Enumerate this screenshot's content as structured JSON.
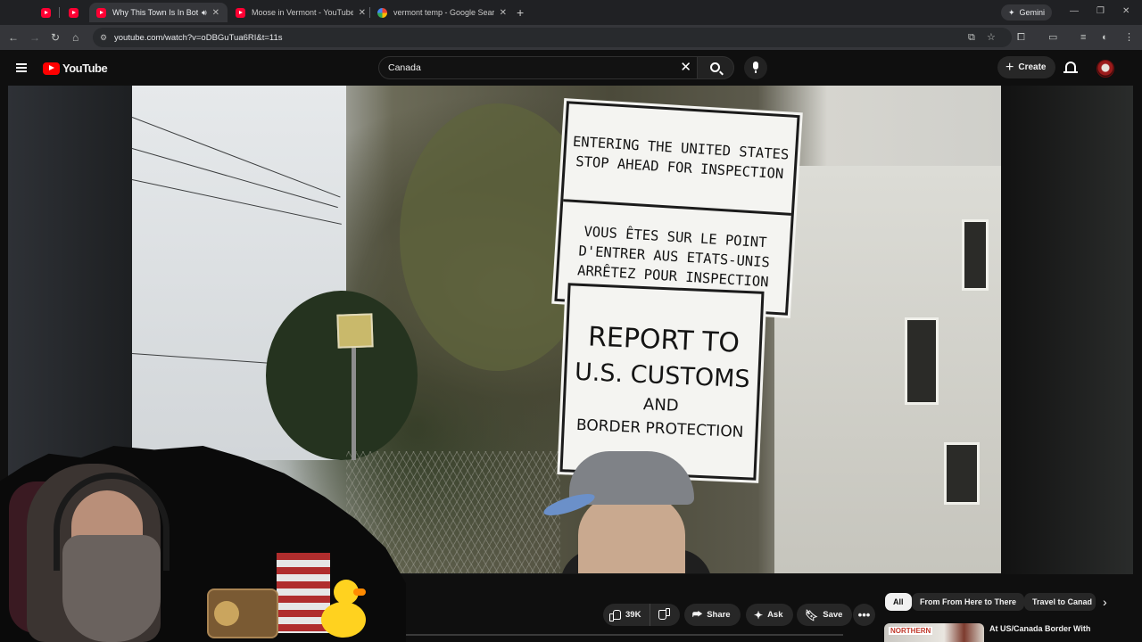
{
  "browser": {
    "tabs": [
      {
        "title": "",
        "favicon": "youtube-icon"
      },
      {
        "title": "",
        "favicon": "youtube-icon"
      },
      {
        "title": "Why This Town Is In Both Th",
        "favicon": "youtube-icon",
        "active": true,
        "audio": true
      },
      {
        "title": "Moose in Vermont - YouTube",
        "favicon": "youtube-icon"
      },
      {
        "title": "vermont temp - Google Search",
        "favicon": "google-icon"
      }
    ],
    "new_tab": "+",
    "gemini_label": "Gemini",
    "url": "youtube.com/watch?v=oDBGuTua6RI&t=11s"
  },
  "youtube": {
    "logo_text": "YouTube",
    "search_value": "Canada",
    "create_label": "Create",
    "actions": {
      "likes": "39K",
      "share": "Share",
      "ask": "Ask",
      "save": "Save"
    },
    "chips": [
      "All",
      "From From Here to There",
      "Travel to Canad"
    ],
    "recommendation": {
      "thumb_label": "NORTHERN",
      "title": "At US/Canada Border With"
    }
  },
  "video": {
    "sign_top_en": [
      "ENTERING THE UNITED STATES",
      "STOP AHEAD FOR INSPECTION"
    ],
    "sign_top_fr": [
      "VOUS ÊTES SUR LE POINT",
      "D'ENTRER AUS ETATS-UNIS",
      "ARRÊTEZ POUR INSPECTION"
    ],
    "sign_bottom": [
      "REPORT TO",
      "U.S. CUSTOMS",
      "AND",
      "BORDER PROTECTION"
    ]
  },
  "colors": {
    "accent": "#ff0000",
    "background": "#0f0f0f",
    "chip": "#272727"
  }
}
